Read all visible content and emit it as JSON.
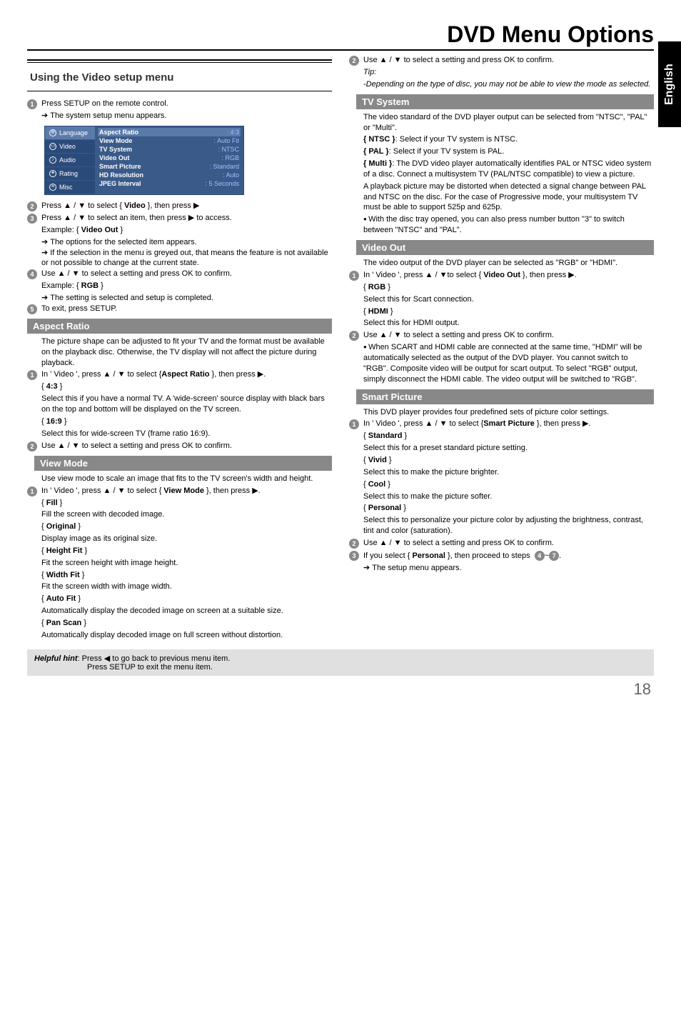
{
  "page_title": "DVD Menu Options",
  "lang_tab": "English",
  "page_number": "18",
  "helpful_hint_label": "Helpful hint",
  "helpful_hint_1": ":  Press ◀ to go back to previous menu item.",
  "helpful_hint_2": "Press SETUP to exit the menu item.",
  "left": {
    "section_title": "Using the Video setup menu",
    "s1": "Press SETUP on the remote control.",
    "s1a": "The system setup menu appears.",
    "menu": {
      "side": [
        "Language",
        "Video",
        "Audio",
        "Rating",
        "Misc"
      ],
      "rows": [
        {
          "l": "Aspect Ratio",
          "v": ": 4:3"
        },
        {
          "l": "View Mode",
          "v": ": Auto Fit"
        },
        {
          "l": "TV System",
          "v": ": NTSC"
        },
        {
          "l": "Video Out",
          "v": ": RGB"
        },
        {
          "l": "Smart Picture",
          "v": ": Standard"
        },
        {
          "l": "HD Resolution",
          "v": ": Auto"
        },
        {
          "l": "JPEG Interval",
          "v": ": 5 Seconds"
        }
      ]
    },
    "s2a": "Press ▲ / ▼ to select { ",
    "s2b": "Video",
    "s2c": " }, then press ▶",
    "s3": "Press ▲ / ▼ to select an item, then press ▶ to access.",
    "s3ex_a": "Example: { ",
    "s3ex_b": "Video Out",
    "s3ex_c": " }",
    "s3arrow1": "The options for the selected item appears.",
    "s3arrow2": "If the selection in the menu is greyed out, that means the feature is not available or not possible to change at the current state.",
    "s4": "Use ▲ / ▼ to select a setting and press OK to confirm.",
    "s4ex_a": "Example: { ",
    "s4ex_b": "RGB",
    "s4ex_c": " }",
    "s4arrow": "The setting is selected and setup is completed.",
    "s5": "To exit, press SETUP.",
    "aspect_title": "Aspect Ratio",
    "aspect_intro": "The picture shape can be adjusted to fit your TV and the format must be available on the playback disc. Otherwise, the TV display will not affect the picture during playback.",
    "aspect_s1a": "In ' Video ', press ▲ / ▼ to select {",
    "aspect_s1b": "Aspect Ratio",
    "aspect_s1c": " }, then press ▶.",
    "k43": "4:3",
    "k43_txt": "Select this if you have a normal TV. A 'wide-screen' source display with black bars on the top and bottom will be displayed on the TV screen.",
    "k169": "16:9",
    "k169_txt": "Select this for wide-screen TV (frame ratio 16:9).",
    "aspect_s2": "Use ▲ / ▼ to select a setting and press OK to confirm.",
    "view_title": "View Mode",
    "view_intro": "Use view mode to scale an image that fits to the TV screen's width and height.",
    "view_s1a": "In ' Video ', press ▲ / ▼ to select { ",
    "view_s1b": "View Mode",
    "view_s1c": " }, then press ▶.",
    "fill": "Fill",
    "fill_txt": "Fill the screen with decoded image.",
    "original": "Original",
    "original_txt": "Display image as its original size.",
    "heightfit": "Height Fit",
    "heightfit_txt": "Fit the screen height with image height.",
    "widthfit": "Width Fit",
    "widthfit_txt": "Fit the screen width with image width.",
    "autofit": "Auto Fit",
    "autofit_txt": "Automatically display the decoded image on screen at a suitable size.",
    "panscan": "Pan Scan",
    "panscan_txt": "Automatically display decoded image on full screen without distortion."
  },
  "right": {
    "s2": "Use ▲ / ▼ to select a setting and press OK to confirm.",
    "tip_lbl": "Tip:",
    "tip_txt": "-Depending on the type of disc, you may not be able to view the mode as selected.",
    "tv_title": "TV System",
    "tv_intro": "The video standard of the DVD player output can be selected from \"NTSC\", \"PAL\" or \"Multi\".",
    "ntsc_b": "{ NTSC }",
    "ntsc_t": ": Select if your TV system is NTSC.",
    "pal_b": "{ PAL }",
    "pal_t": ": Select if your TV system is PAL.",
    "multi_b": "{ Multi }",
    "multi_t": ": The DVD video player automatically identifies PAL or NTSC video system of a disc. Connect a multisystem TV (PAL/NTSC compatible) to view a picture.",
    "tv_para2": "A playback picture may be distorted when detected a signal change between PAL and NTSC on the disc. For the case of Progressive mode, your multisystem TV must be able to support 525p and 625p.",
    "tv_bullet": "With the disc tray opened, you can also press number button \"3\" to switch between \"NTSC\" and \"PAL\".",
    "vo_title": "Video Out",
    "vo_intro": "The video output of the DVD player can be selected as \"RGB\" or \"HDMI\".",
    "vo_s1a": "In ' Video ', press ▲ / ▼to select { ",
    "vo_s1b": "Video Out",
    "vo_s1c": " }, then press ▶.",
    "rgb": "RGB",
    "rgb_txt": "Select this for Scart connection.",
    "hdmi": "HDMI",
    "hdmi_txt": "Select this for HDMI output.",
    "vo_s2": "Use ▲ / ▼ to select a setting and press OK to confirm.",
    "vo_bullet": "When SCART and HDMI cable are connected at the same time, \"HDMI\" will be automatically selected as the output of the DVD player. You cannot switch to \"RGB\". Composite video will be output for scart output. To select \"RGB\" output, simply disconnect the HDMI cable. The video output will be switched to \"RGB\".",
    "sp_title": "Smart Picture",
    "sp_intro": "This DVD player provides four predefined sets of picture color settings.",
    "sp_s1a": "In ' Video ', press ▲ / ▼ to select {",
    "sp_s1b": "Smart Picture",
    "sp_s1c": " }, then press ▶.",
    "std": "Standard",
    "std_txt": "Select this for a preset standard picture setting.",
    "vivid": "Vivid",
    "vivid_txt": "Select this to make the picture brighter.",
    "cool": "Cool",
    "cool_txt": "Select this to make the picture softer.",
    "personal": "Personal",
    "personal_txt": "Select this to personalize your picture color by adjusting the brightness, contrast, tint and color (saturation).",
    "sp_s2": "Use ▲ / ▼ to select a setting and press OK to confirm.",
    "sp_s3a": "If you select { ",
    "sp_s3b": "Personal",
    "sp_s3c": " }, then proceed to steps",
    "sp_s3d": "~",
    "sp_s3e": ".",
    "sp_arrow": "The setup menu appears."
  }
}
